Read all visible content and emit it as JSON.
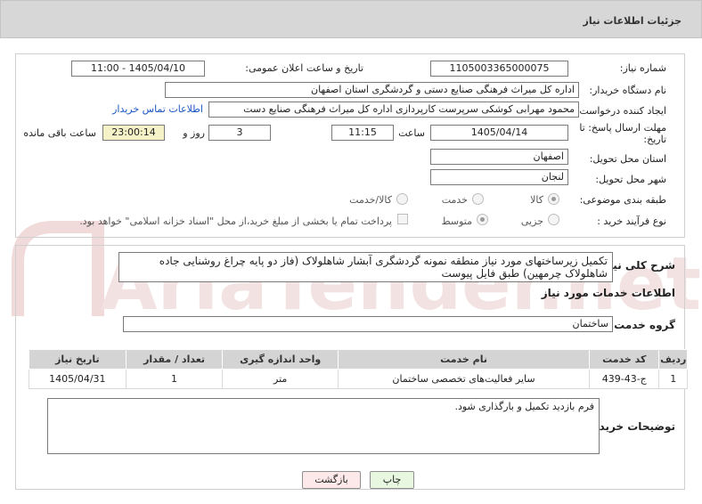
{
  "header": {
    "title": "جزئیات اطلاعات نیاز"
  },
  "form": {
    "need_number_label": "شماره نیاز:",
    "need_number": "1105003365000075",
    "announce_label": "تاریخ و ساعت اعلان عمومی:",
    "announce_value": "1405/04/10 - 11:00",
    "buyer_org_label": "نام دستگاه خریدار:",
    "buyer_org": "اداره کل میراث فرهنگی  صنایع دستی و گردشگری استان اصفهان",
    "creator_label": "ایجاد کننده درخواست:",
    "creator": "محمود مهرابی کوشکی سرپرست کارپردازی اداره کل میراث فرهنگی  صنایع دست",
    "contact_link": "اطلاعات تماس خریدار",
    "deadline_label_line1": "مهلت ارسال پاسخ: تا",
    "deadline_label_line2": "تاریخ:",
    "deadline_date": "1405/04/14",
    "time_label": "ساعت",
    "deadline_time": "11:15",
    "days_value": "3",
    "days_label": "روز و",
    "remaining_time": "23:00:14",
    "remaining_label": "ساعت باقی مانده",
    "province_label": "استان محل تحویل:",
    "province": "اصفهان",
    "city_label": "شهر محل تحویل:",
    "city": "لنجان",
    "category_label": "طبقه بندی موضوعی:",
    "category_options": [
      "کالا",
      "خدمت",
      "کالا/خدمت"
    ],
    "process_label": "نوع فرآیند خرید :",
    "process_options": [
      "جزیی",
      "متوسط"
    ],
    "payment_note": "پرداخت تمام یا بخشی از مبلغ خرید،از محل \"اسناد خزانه اسلامی\" خواهد بود."
  },
  "summary": {
    "label": "شرح کلی نیاز:",
    "text": "تکمیل زیرساختهای مورد نیاز منطقه نمونه گردشگری آبشار شاهلولاک (فاز دو پایه چراغ روشنایی جاده شاهلولاک چرمهین) طبق فایل پیوست"
  },
  "services": {
    "section_title": "اطلاعات خدمات مورد نیاز",
    "group_label": "گروه خدمت:",
    "group_value": "ساختمان",
    "columns": [
      "ردیف",
      "کد خدمت",
      "نام خدمت",
      "واحد اندازه گیری",
      "تعداد / مقدار",
      "تاریخ نیاز"
    ],
    "rows": [
      {
        "row": "1",
        "code": "ج-43-439",
        "name": "سایر فعالیت‌های تخصصی ساختمان",
        "unit": "متر",
        "qty": "1",
        "date": "1405/04/31"
      }
    ]
  },
  "buyer_notes": {
    "label": "توضیحات خریدار:",
    "text": "فرم بازدید تکمیل و بارگذاری شود."
  },
  "buttons": {
    "print": "چاپ",
    "back": "بازگشت"
  },
  "watermark": {
    "text": "AriaTender.net"
  },
  "colors": {
    "header_bg": "#d7d7d7",
    "link": "#1a56c4",
    "print_btn": "#e8f8e0",
    "back_btn": "#fde8ea",
    "watermark": "#f1dada"
  }
}
